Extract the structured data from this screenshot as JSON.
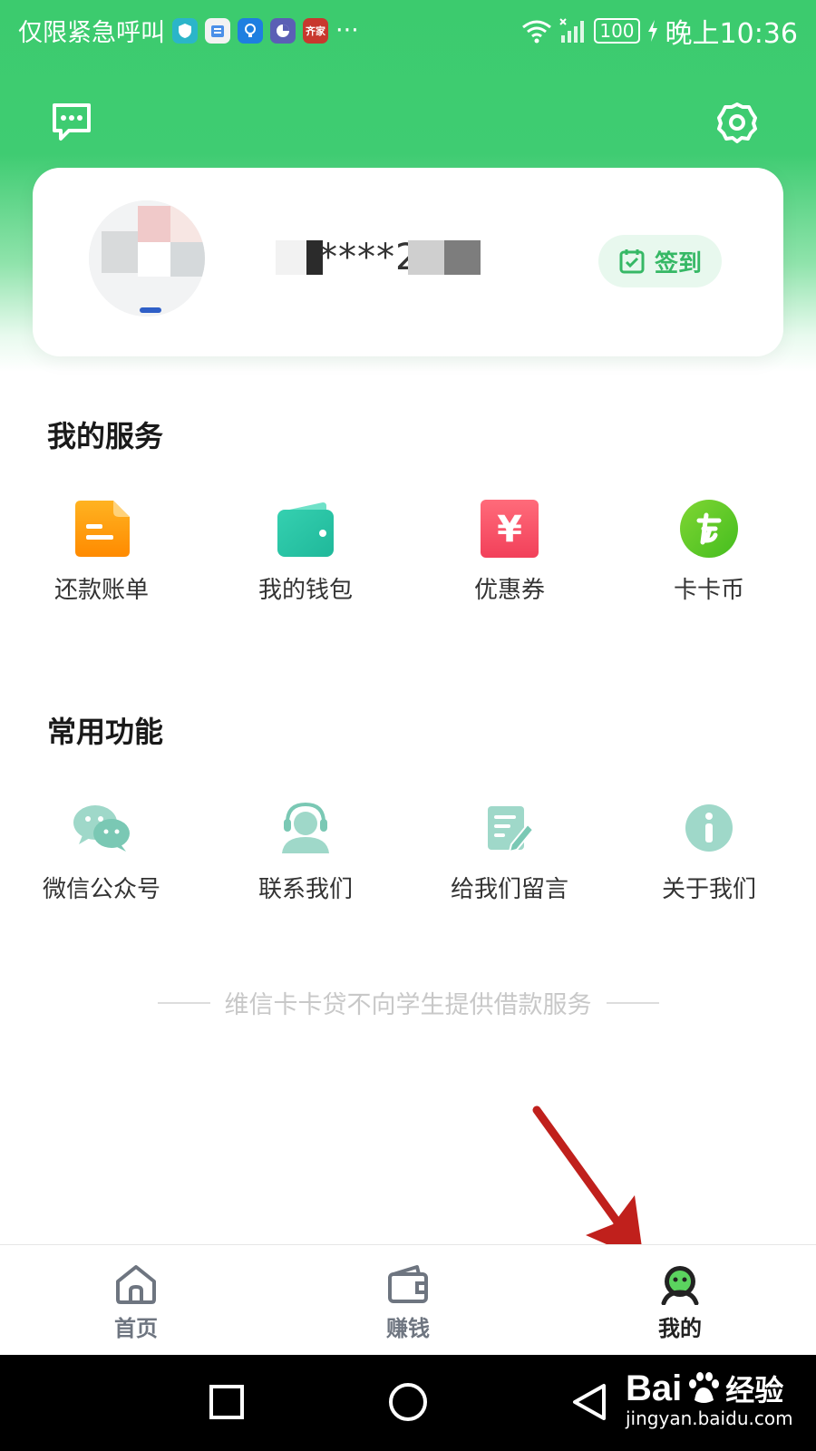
{
  "status_bar": {
    "left_text": "仅限紧急呼叫",
    "notif_text": "齐家",
    "more": "···",
    "battery": "100",
    "time": "晚上10:36"
  },
  "header": {
    "message_icon": "message-icon",
    "settings_icon": "gear-icon"
  },
  "profile": {
    "username": "****2",
    "signin_label": "签到"
  },
  "my_services": {
    "title": "我的服务",
    "items": [
      {
        "label": "还款账单",
        "icon": "bill-icon"
      },
      {
        "label": "我的钱包",
        "icon": "wallet-icon"
      },
      {
        "label": "优惠券",
        "icon": "coupon-icon"
      },
      {
        "label": "卡卡币",
        "icon": "coin-icon"
      }
    ]
  },
  "common_functions": {
    "title": "常用功能",
    "items": [
      {
        "label": "微信公众号",
        "icon": "wechat-icon"
      },
      {
        "label": "联系我们",
        "icon": "customer-service-icon"
      },
      {
        "label": "给我们留言",
        "icon": "feedback-icon"
      },
      {
        "label": "关于我们",
        "icon": "info-icon"
      }
    ]
  },
  "disclaimer": "维信卡卡贷不向学生提供借款服务",
  "tab_bar": {
    "tabs": [
      {
        "label": "首页",
        "icon": "home-icon",
        "active": false
      },
      {
        "label": "赚钱",
        "icon": "earn-icon",
        "active": false
      },
      {
        "label": "我的",
        "icon": "mine-icon",
        "active": true
      }
    ]
  },
  "watermark": {
    "brand": "Bai",
    "brand_suffix": "经验",
    "site": "jingyan.baidu.com"
  },
  "colors": {
    "brand_green": "#3ccb6e",
    "arrow_red": "#c0201c"
  }
}
